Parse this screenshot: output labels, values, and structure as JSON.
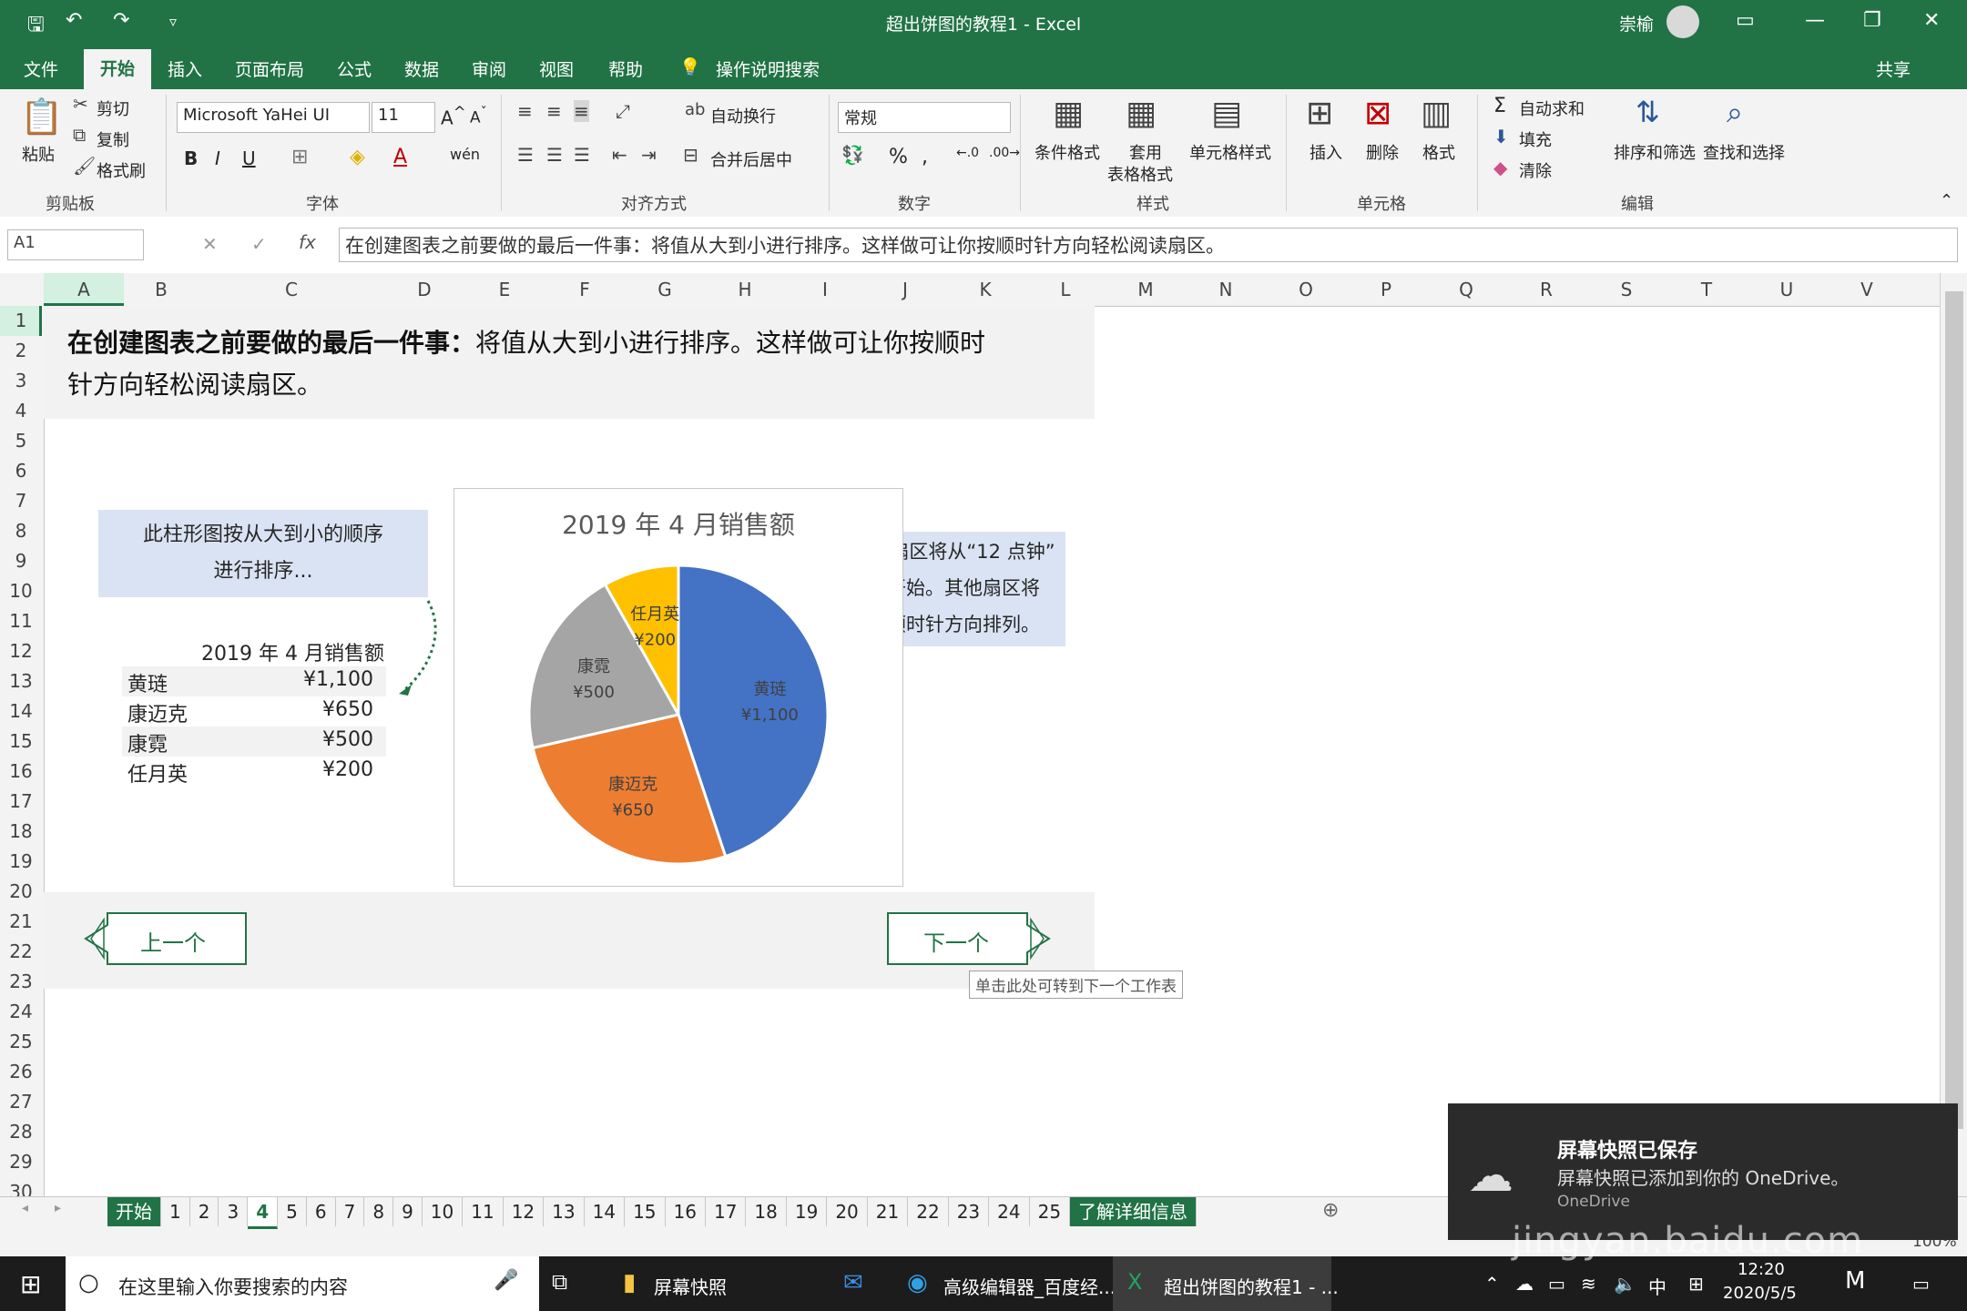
{
  "app": {
    "title": "超出饼图的教程1  -  Excel",
    "user": "崇榆",
    "share": "共享"
  },
  "ribbon_tabs": [
    "文件",
    "开始",
    "插入",
    "页面布局",
    "公式",
    "数据",
    "审阅",
    "视图",
    "帮助",
    "操作说明搜索"
  ],
  "ribbon": {
    "paste": "粘贴",
    "cut": "剪切",
    "copy": "复制",
    "format_painter": "格式刷",
    "clipboard": "剪贴板",
    "font_name": "Microsoft YaHei UI",
    "font_size": "11",
    "font_group": "字体",
    "wrap": "自动换行",
    "merge": "合并后居中",
    "align_group": "对齐方式",
    "number_format": "常规",
    "number_group": "数字",
    "cond_format": "条件格式",
    "table_format_1": "套用",
    "table_format_2": "表格格式",
    "cell_style": "单元格样式",
    "style_group": "样式",
    "insert": "插入",
    "delete": "删除",
    "format": "格式",
    "cells_group": "单元格",
    "autosum": "自动求和",
    "fill": "填充",
    "clear": "清除",
    "sort": "排序和筛选",
    "find": "查找和选择",
    "edit_group": "编辑"
  },
  "formula_bar": {
    "cell_ref": "A1",
    "formula": "在创建图表之前要做的最后一件事：将值从大到小进行排序。这样做可让你按顺时针方向轻松阅读扇区。"
  },
  "columns": [
    "A",
    "B",
    "C",
    "D",
    "E",
    "F",
    "G",
    "H",
    "I",
    "J",
    "K",
    "L",
    "M",
    "N",
    "O",
    "P",
    "Q",
    "R",
    "S",
    "T",
    "U",
    "V"
  ],
  "rows": [
    "1",
    "2",
    "3",
    "4",
    "5",
    "6",
    "7",
    "8",
    "9",
    "10",
    "11",
    "12",
    "13",
    "14",
    "15",
    "16",
    "17",
    "18",
    "19",
    "20",
    "21",
    "22",
    "23",
    "24",
    "25",
    "26",
    "27",
    "28",
    "29",
    "30"
  ],
  "content": {
    "intro_bold": "在创建图表之前要做的最后一件事：",
    "intro_line1": "将值从大到小进行排序。这样做可让你按顺时",
    "intro_line2": "针方向轻松阅读扇区。",
    "note_left_1": "此柱形图按从大到小的顺序",
    "note_left_2": "进行排序...",
    "note_right_1": "...最大扇区将从“12 点钟”",
    "note_right_2": "位置开始。其他扇区将",
    "note_right_3": "按照顺时针方向排列。",
    "table_title": "2019 年 4 月销售额",
    "table_rows": [
      {
        "name": "黄琏",
        "value": "¥1,100"
      },
      {
        "name": "康迈克",
        "value": "¥650"
      },
      {
        "name": "康霓",
        "value": "¥500"
      },
      {
        "name": "任月英",
        "value": "¥200"
      }
    ],
    "prev_button": "上一个",
    "next_button": "下一个",
    "tooltip": "单击此处可转到下一个工作表"
  },
  "chart_data": {
    "type": "pie",
    "title": "2019 年 4 月销售额",
    "categories": [
      "黄琏",
      "康迈克",
      "康霓",
      "任月英"
    ],
    "values": [
      1100,
      650,
      500,
      200
    ],
    "labels": [
      "¥1,100",
      "¥650",
      "¥500",
      "¥200"
    ],
    "colors": [
      "#4472c4",
      "#ed7d31",
      "#a5a5a5",
      "#ffc000"
    ],
    "start": "12 o'clock",
    "direction": "clockwise"
  },
  "sheet_tabs": [
    "开始",
    "1",
    "2",
    "3",
    "4",
    "5",
    "6",
    "7",
    "8",
    "9",
    "10",
    "11",
    "12",
    "13",
    "14",
    "15",
    "16",
    "17",
    "18",
    "19",
    "20",
    "21",
    "22",
    "23",
    "24",
    "25",
    "了解详细信息"
  ],
  "active_sheet": "4",
  "zoom": "100%",
  "taskbar": {
    "search_placeholder": "在这里输入你要搜索的内容",
    "apps": [
      "屏幕快照",
      "高级编辑器_百度经...",
      "超出饼图的教程1 - ..."
    ],
    "time": "12:20",
    "date": "2020/5/5",
    "ime": "中"
  },
  "toast": {
    "title": "屏幕快照已保存",
    "body": "屏幕快照已添加到你的 OneDrive。",
    "source": "OneDrive"
  },
  "watermark": "jingyan.baidu.com"
}
